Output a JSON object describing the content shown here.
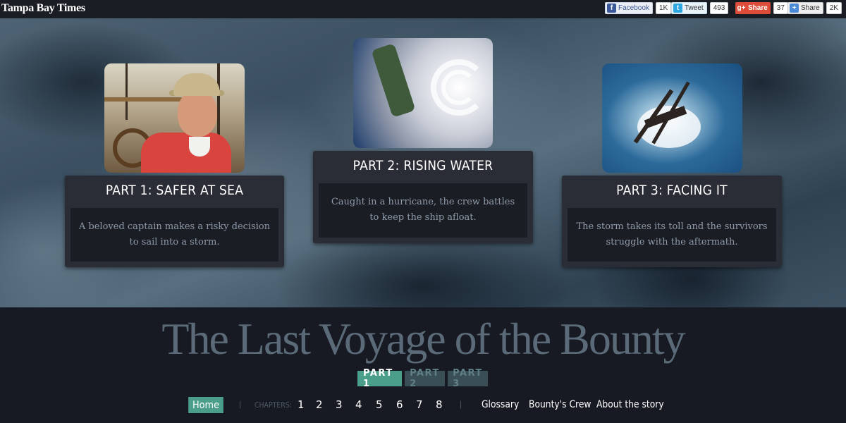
{
  "header": {
    "logo": "Tampa Bay Times",
    "social": {
      "facebook": {
        "label": "Facebook",
        "count": "1K"
      },
      "twitter": {
        "label": "Tweet",
        "count": "493"
      },
      "googleplus": {
        "label": "Share",
        "count": "37"
      },
      "share": {
        "label": "Share",
        "count": "2K"
      }
    }
  },
  "parts": [
    {
      "title": "PART 1: SAFER AT SEA",
      "description": "A beloved captain makes a risky decision to sail into a storm."
    },
    {
      "title": "PART 2: RISING WATER",
      "description": "Caught in a hurricane, the crew battles to keep the ship afloat."
    },
    {
      "title": "PART 3: FACING IT",
      "description": "The storm takes its toll and the survivors struggle with the aftermath."
    }
  ],
  "site_title": "The Last Voyage of the Bounty",
  "part_tabs": [
    "PART 1",
    "PART 2",
    "PART 3"
  ],
  "nav": {
    "home": "Home",
    "chapters_label": "CHAPTERS:",
    "chapters": [
      "1",
      "2",
      "3",
      "4",
      "5",
      "6",
      "7",
      "8"
    ],
    "links": [
      "Glossary",
      "Bounty's Crew",
      "About the story"
    ]
  },
  "colors": {
    "accent": "#4a9e8a",
    "background": "#171a22",
    "title_text": "#5b6a78"
  }
}
